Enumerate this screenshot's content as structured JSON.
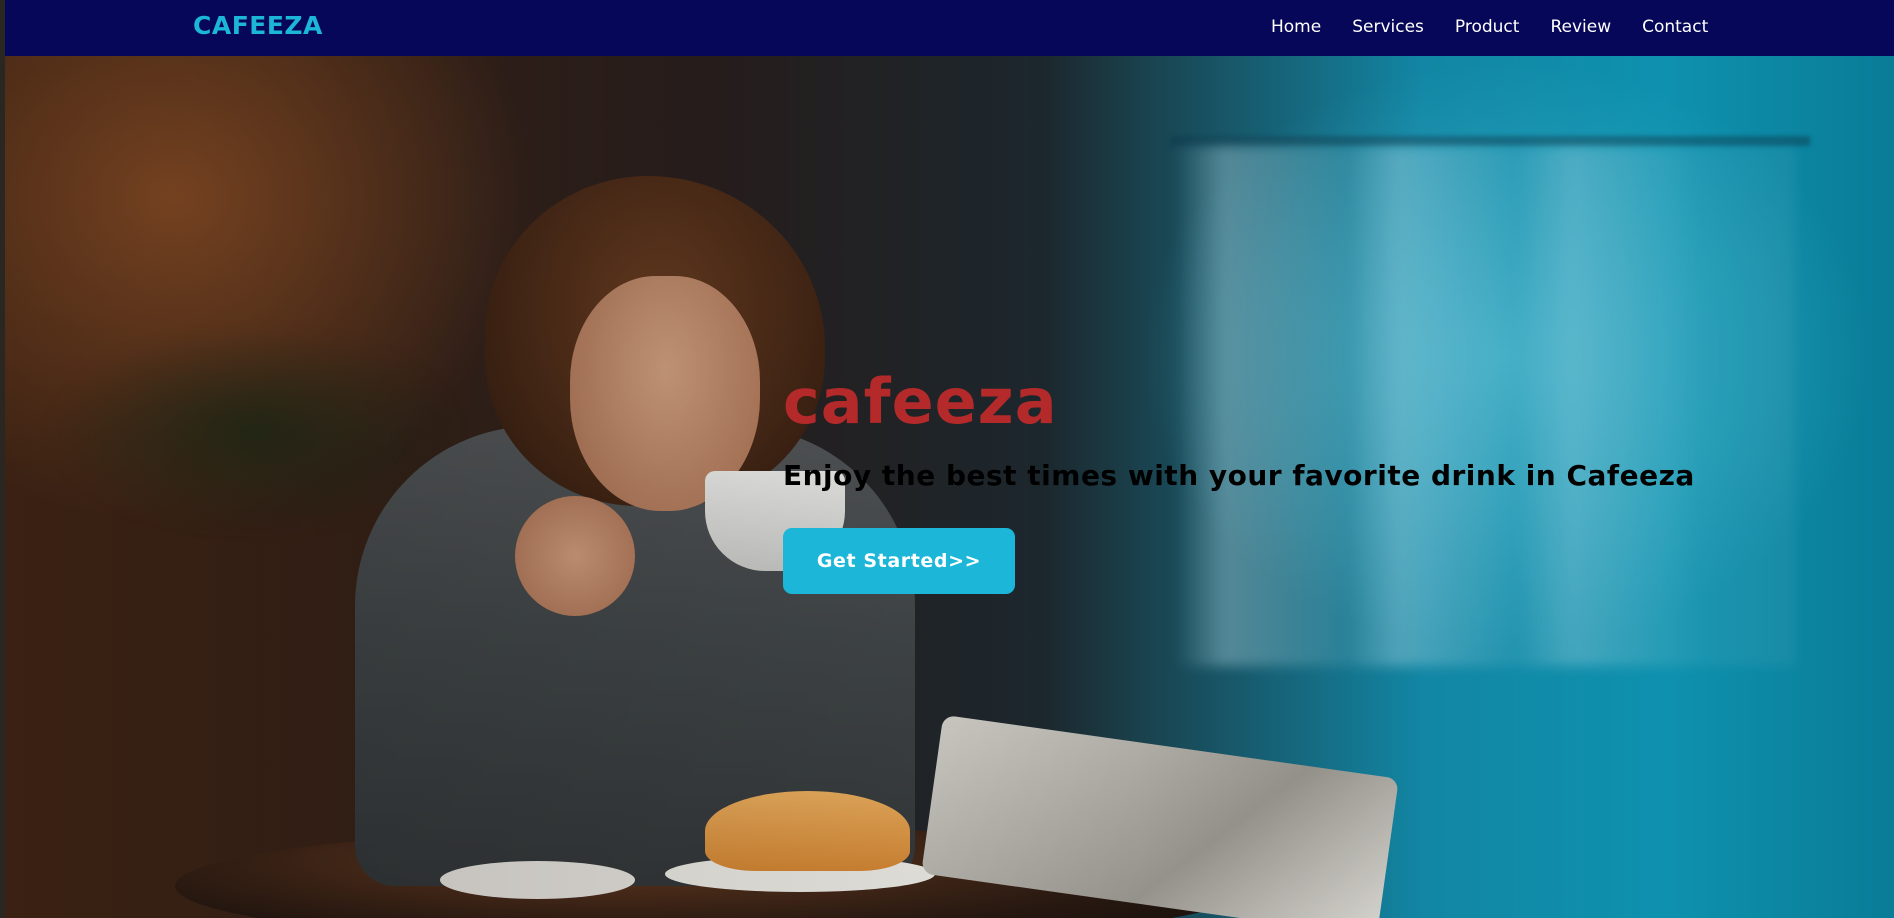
{
  "navbar": {
    "brand": "CAFEEZA",
    "links": [
      {
        "label": "Home"
      },
      {
        "label": "Services"
      },
      {
        "label": "Product"
      },
      {
        "label": "Review"
      },
      {
        "label": "Contact"
      }
    ]
  },
  "hero": {
    "title": "cafeeza",
    "subtitle": "Enjoy the best times with your favorite drink in Cafeeza",
    "cta_label": "Get Started>>"
  },
  "colors": {
    "navbar_background": "#07075a",
    "brand": "#1bb6d8",
    "hero_title": "#b42a2a",
    "cta_background": "#1bb6d8",
    "cta_text": "#ffffff",
    "subtitle": "#000000"
  }
}
